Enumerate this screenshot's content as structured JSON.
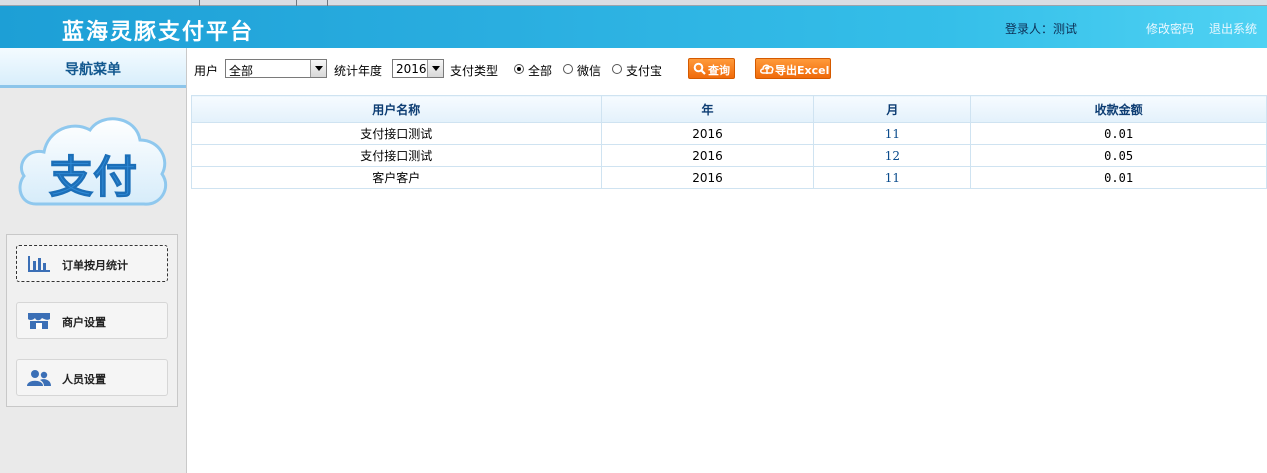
{
  "header": {
    "title": "蓝海灵豚支付平台",
    "login_user": "登录人：测试",
    "change_password": "修改密码",
    "logout": "退出系统"
  },
  "sidebar": {
    "nav_title": "导航菜单",
    "logo_text": "支付",
    "items": [
      {
        "label": "订单按月统计",
        "icon": "bar-chart-icon",
        "active": true
      },
      {
        "label": "商户设置",
        "icon": "store-icon",
        "active": false
      },
      {
        "label": "人员设置",
        "icon": "users-icon",
        "active": false
      }
    ]
  },
  "filters": {
    "user_label": "用户",
    "user_value": "全部",
    "year_label": "统计年度",
    "year_value": "2016",
    "paytype_label": "支付类型",
    "paytype_options": [
      {
        "label": "全部",
        "checked": true
      },
      {
        "label": "微信",
        "checked": false
      },
      {
        "label": "支付宝",
        "checked": false
      }
    ],
    "query_button": "查询",
    "export_button": "导出Excel"
  },
  "table": {
    "columns": [
      "用户名称",
      "年",
      "月",
      "收款金额"
    ],
    "rows": [
      [
        "支付接口测试",
        "2016",
        "11",
        "0.01"
      ],
      [
        "支付接口测试",
        "2016",
        "12",
        "0.05"
      ],
      [
        "客户客户",
        "2016",
        "11",
        "0.01"
      ]
    ]
  },
  "colors": {
    "header_gradient_start": "#1d9fd6",
    "header_gradient_end": "#4fd2f3",
    "accent_orange": "#f06a0a",
    "nav_title_text": "#12588f",
    "icon_blue": "#3b6fb6"
  }
}
